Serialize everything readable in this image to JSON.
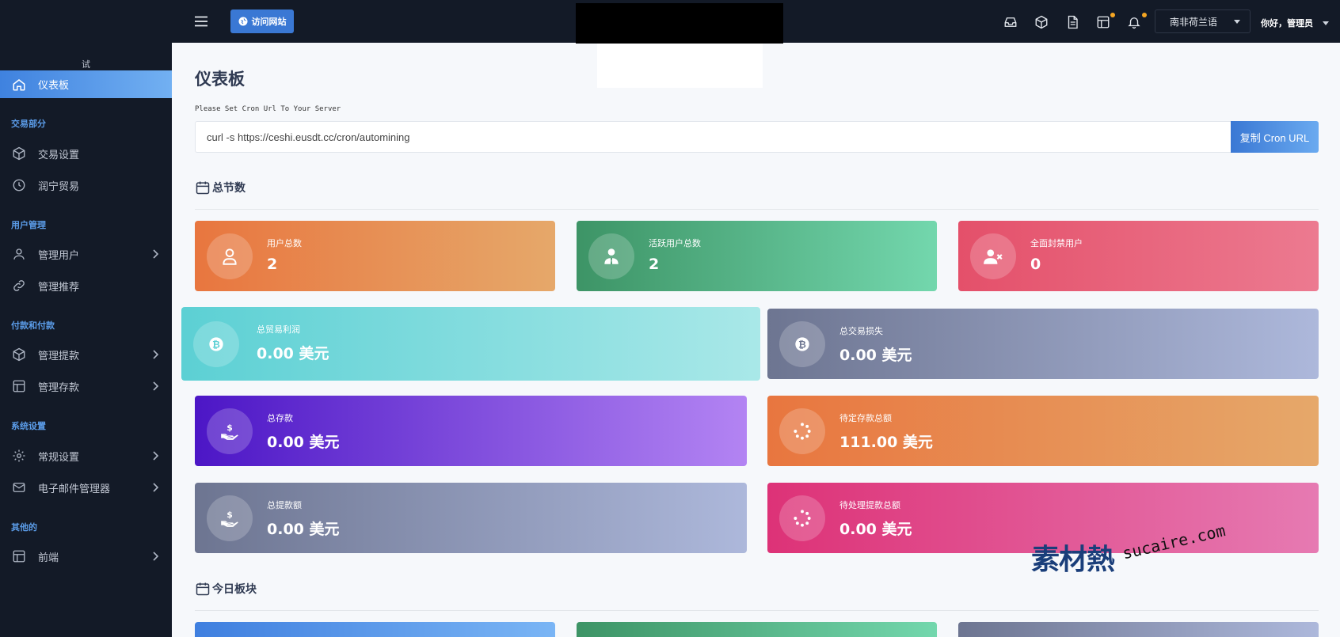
{
  "sidebar": {
    "logo_text": "试",
    "active": {
      "label": "仪表板",
      "icon": "home-icon"
    },
    "sections": [
      {
        "title": "交易部分",
        "items": [
          {
            "label": "交易设置",
            "icon": "cube-icon",
            "chevron": false
          },
          {
            "label": "润宁贸易",
            "icon": "clock-icon",
            "chevron": false
          }
        ]
      },
      {
        "title": "用户管理",
        "items": [
          {
            "label": "管理用户",
            "icon": "user-icon",
            "chevron": true
          },
          {
            "label": "管理推荐",
            "icon": "link-icon",
            "chevron": false
          }
        ]
      },
      {
        "title": "付款和付款",
        "items": [
          {
            "label": "管理提款",
            "icon": "cube-icon",
            "chevron": true
          },
          {
            "label": "管理存款",
            "icon": "table-icon",
            "chevron": true
          }
        ]
      },
      {
        "title": "系统设置",
        "items": [
          {
            "label": "常规设置",
            "icon": "gear-icon",
            "chevron": true
          },
          {
            "label": "电子邮件管理器",
            "icon": "mail-icon",
            "chevron": true
          }
        ]
      },
      {
        "title": "其他的",
        "items": [
          {
            "label": "前端",
            "icon": "layout-icon",
            "chevron": true
          }
        ]
      }
    ]
  },
  "topbar": {
    "visit_label": "访问网站",
    "language": "南非荷兰语",
    "greeting": "你好，管理员",
    "icons": [
      "inbox-icon",
      "cube-icon",
      "document-icon",
      "table-icon",
      "bell-icon"
    ]
  },
  "main": {
    "title": "仪表板",
    "cron_label": "Please Set Cron Url To Your Server",
    "cron_value": "curl -s https://ceshi.eusdt.cc/cron/automining",
    "cron_button": "复制 Cron URL",
    "section_total": "总节数",
    "section_today": "今日板块",
    "cards": [
      {
        "label": "用户总数",
        "value": "2",
        "icon": "user-outline-icon",
        "color": "#e8763f"
      },
      {
        "label": "活跃用户总数",
        "value": "2",
        "icon": "user-tie-icon",
        "color": "#3d9466"
      },
      {
        "label": "全面封禁用户",
        "value": "0",
        "icon": "user-x-icon",
        "color": "#e4506a"
      },
      {
        "label": "总贸易利润",
        "value": "0.00 美元",
        "icon": "bitcoin-icon",
        "color": "#5cd0d4"
      },
      {
        "label": "总交易损失",
        "value": "0.00 美元",
        "icon": "bitcoin-icon",
        "color": "#6d7591"
      },
      {
        "label": "总存款",
        "value": "0.00 美元",
        "icon": "hand-dollar-icon",
        "color": "#4c16c6"
      },
      {
        "label": "待定存款总额",
        "value": "111.00 美元",
        "icon": "spinner-icon",
        "color": "#e8763f"
      },
      {
        "label": "总提款额",
        "value": "0.00 美元",
        "icon": "hand-dollar-icon",
        "color": "#6d7591"
      },
      {
        "label": "待处理提款总额",
        "value": "0.00 美元",
        "icon": "spinner-icon",
        "color": "#dd3277"
      }
    ]
  },
  "watermark": {
    "cn": "素材熱",
    "en": "sucaire.com"
  }
}
